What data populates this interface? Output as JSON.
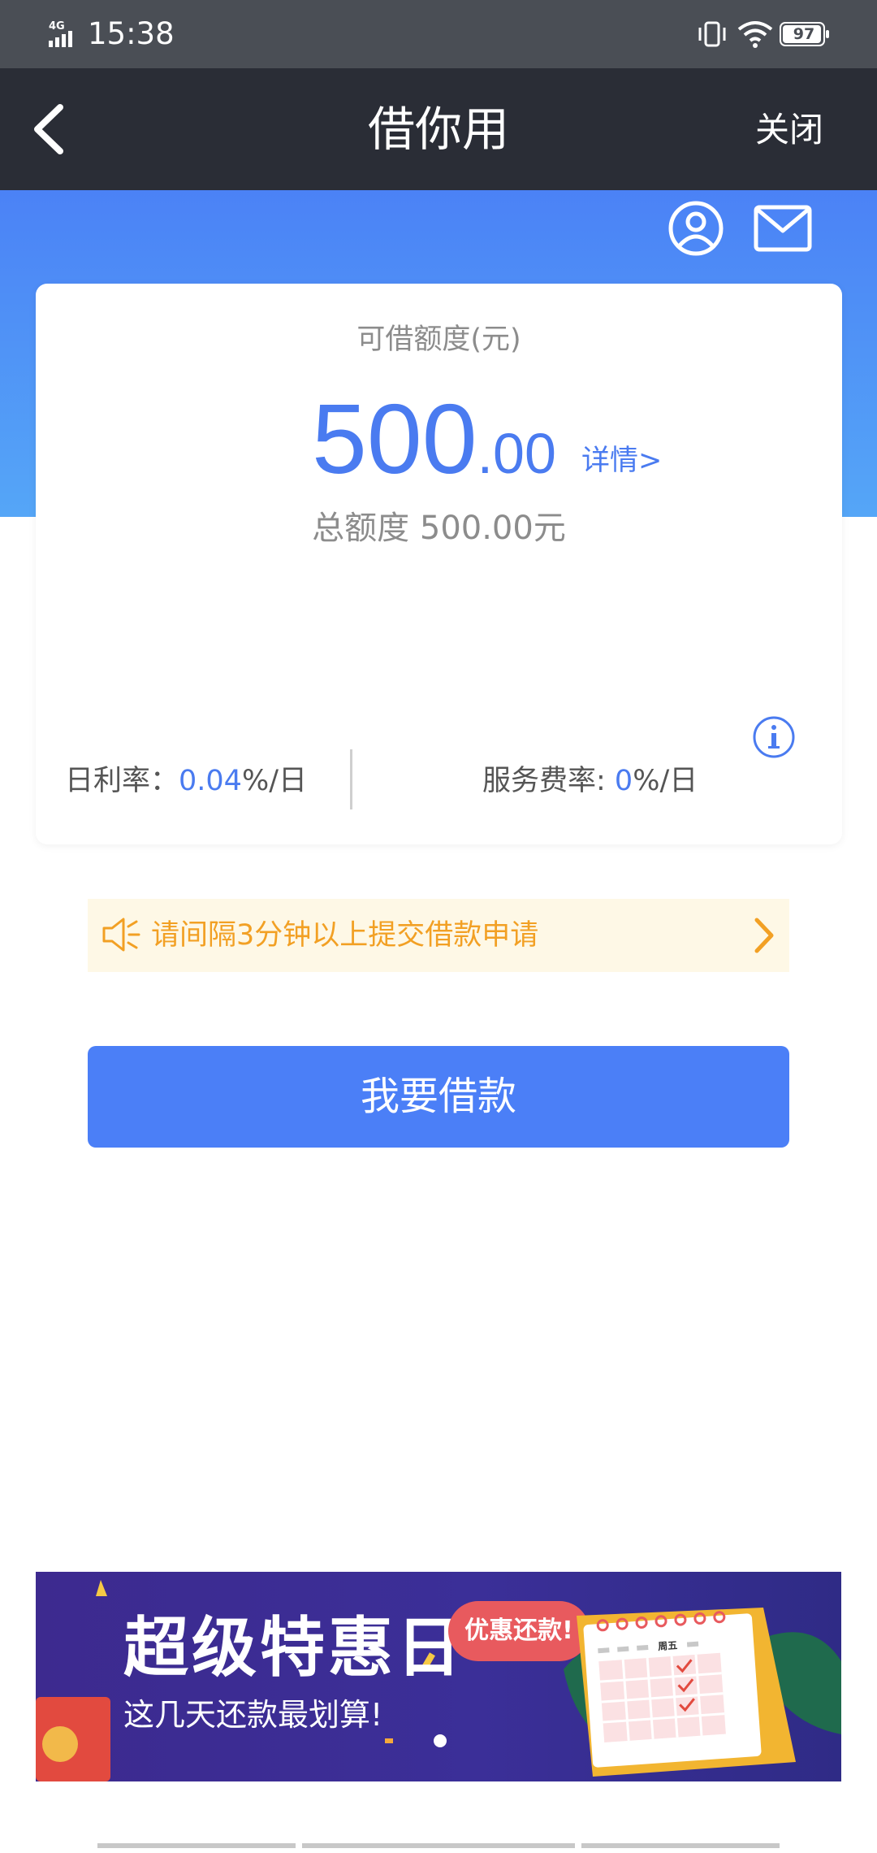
{
  "status_bar": {
    "network": "4G",
    "time": "15:38",
    "battery": "97"
  },
  "nav": {
    "title": "借你用",
    "close_label": "关闭"
  },
  "card": {
    "title": "可借额度(元)",
    "amount_int": "500",
    "amount_dec": ".00",
    "detail_label": "详情>",
    "total": "总额度 500.00元",
    "daily_rate_label": "日利率：",
    "daily_rate_value": "0.04",
    "daily_rate_unit": "%/日",
    "service_rate_label": "服务费率: ",
    "service_rate_value": "0",
    "service_rate_unit": "%/日"
  },
  "notice": {
    "text": "请间隔3分钟以上提交借款申请"
  },
  "borrow_button": {
    "label": "我要借款"
  },
  "banner": {
    "title": "超级特惠日",
    "subtitle": "这几天还款最划算!",
    "bubble": "优惠还款!",
    "calendar_day": "周五"
  },
  "colors": {
    "accent": "#4b7ff7",
    "nav_bg": "#2a2d36",
    "notice_text": "#f2a024",
    "banner_bg": "#3d2a8f"
  }
}
